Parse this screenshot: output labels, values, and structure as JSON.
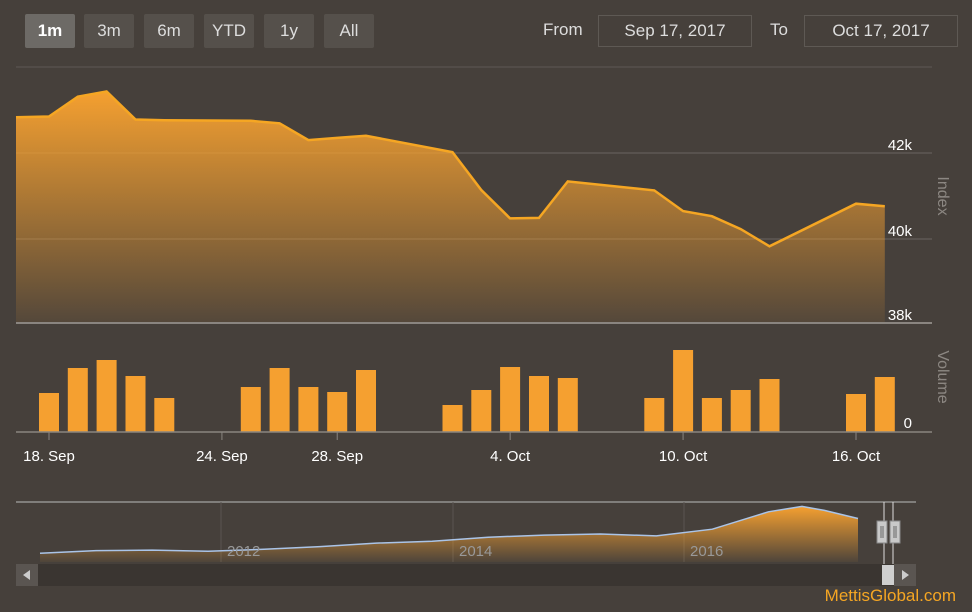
{
  "range_selector": {
    "buttons": [
      "1m",
      "3m",
      "6m",
      "YTD",
      "1y",
      "All"
    ],
    "active": "1m"
  },
  "input": {
    "from_label": "From",
    "from_value": "Sep 17, 2017",
    "to_label": "To",
    "to_value": "Oct 17, 2017"
  },
  "credit": "MettisGlobal.com",
  "colors": {
    "background": "#46403b",
    "accent": "#f5a623",
    "navigator_line": "#aac4e8"
  },
  "chart_data": [
    {
      "type": "area",
      "ylabel": "Index",
      "ylim": [
        38000,
        44000
      ],
      "yticks": [
        "42k",
        "40k",
        "38k"
      ],
      "grid": true,
      "series": [
        {
          "x": [
            "2017-09-15",
            "2017-09-18",
            "2017-09-19",
            "2017-09-20",
            "2017-09-21",
            "2017-09-22",
            "2017-09-25",
            "2017-09-26",
            "2017-09-27",
            "2017-09-28",
            "2017-09-29",
            "2017-10-02",
            "2017-10-03",
            "2017-10-04",
            "2017-10-05",
            "2017-10-06",
            "2017-10-09",
            "2017-10-10",
            "2017-10-11",
            "2017-10-12",
            "2017-10-13",
            "2017-10-16",
            "2017-10-17"
          ],
          "values": [
            42830,
            42850,
            43310,
            43430,
            42780,
            42760,
            42750,
            42690,
            42300,
            42350,
            42400,
            42020,
            41140,
            40480,
            40490,
            41340,
            41130,
            40650,
            40530,
            40230,
            39830,
            40820,
            40760
          ]
        }
      ]
    },
    {
      "type": "bar",
      "ylabel": "Volume",
      "yticks": [
        "0"
      ],
      "x": [
        "2017-09-15",
        "2017-09-18",
        "2017-09-19",
        "2017-09-20",
        "2017-09-21",
        "2017-09-22",
        "2017-09-25",
        "2017-09-26",
        "2017-09-27",
        "2017-09-28",
        "2017-09-29",
        "2017-10-02",
        "2017-10-03",
        "2017-10-04",
        "2017-10-05",
        "2017-10-06",
        "2017-10-09",
        "2017-10-10",
        "2017-10-11",
        "2017-10-12",
        "2017-10-13",
        "2017-10-16",
        "2017-10-17"
      ],
      "values": [
        39,
        64,
        72,
        56,
        34,
        45,
        64,
        45,
        40,
        62,
        27,
        42,
        65,
        56,
        54,
        34,
        82,
        34,
        42,
        53,
        38,
        55
      ],
      "xticks": [
        {
          "date": "2017-09-18",
          "label": "18. Sep"
        },
        {
          "date": "2017-09-24",
          "label": "24. Sep"
        },
        {
          "date": "2017-09-28",
          "label": "28. Sep"
        },
        {
          "date": "2017-10-04",
          "label": "4. Oct"
        },
        {
          "date": "2017-10-10",
          "label": "10. Oct"
        },
        {
          "date": "2017-10-16",
          "label": "16. Oct"
        }
      ]
    },
    {
      "type": "area",
      "role": "navigator",
      "xticks": [
        "2012",
        "2014",
        "2016"
      ],
      "x": [
        2010.5,
        2011,
        2011.5,
        2012,
        2012.5,
        2013,
        2013.5,
        2014,
        2014.5,
        2015,
        2015.5,
        2016,
        2016.5,
        2017,
        2017.3,
        2017.5,
        2017.8
      ],
      "values": [
        10,
        20,
        22,
        18,
        25,
        35,
        48,
        55,
        70,
        78,
        82,
        75,
        100,
        165,
        185,
        170,
        140
      ]
    }
  ]
}
